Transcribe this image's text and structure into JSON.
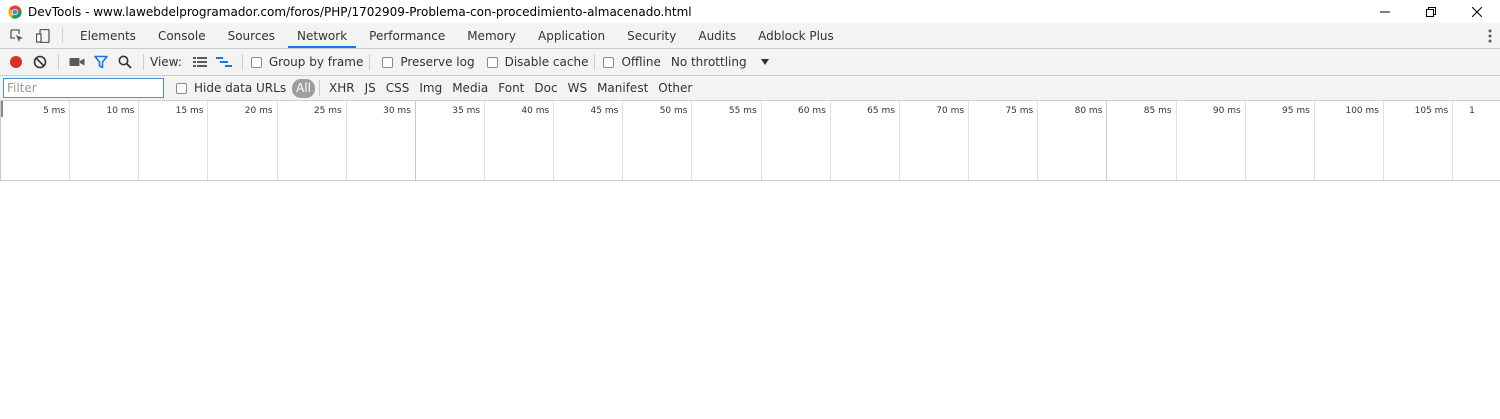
{
  "window": {
    "title": "DevTools - www.lawebdelprogramador.com/foros/PHP/1702909-Problema-con-procedimiento-almacenado.html",
    "app_icon": "chrome-icon",
    "controls": [
      "minimize-icon",
      "maximize-icon",
      "close-icon"
    ]
  },
  "tabs": [
    {
      "label": "Elements",
      "active": false
    },
    {
      "label": "Console",
      "active": false
    },
    {
      "label": "Sources",
      "active": false
    },
    {
      "label": "Network",
      "active": true
    },
    {
      "label": "Performance",
      "active": false
    },
    {
      "label": "Memory",
      "active": false
    },
    {
      "label": "Application",
      "active": false
    },
    {
      "label": "Security",
      "active": false
    },
    {
      "label": "Audits",
      "active": false
    },
    {
      "label": "Adblock Plus",
      "active": false
    }
  ],
  "toolbar": {
    "view_label": "View:",
    "group_by_frame": "Group by frame",
    "preserve_log": "Preserve log",
    "disable_cache": "Disable cache",
    "offline": "Offline",
    "throttling": "No throttling"
  },
  "filterbar": {
    "placeholder": "Filter",
    "hide_data_urls": "Hide data URLs",
    "types": [
      "All",
      "XHR",
      "JS",
      "CSS",
      "Img",
      "Media",
      "Font",
      "Doc",
      "WS",
      "Manifest",
      "Other"
    ],
    "active_type": "All"
  },
  "timeline": {
    "ticks": [
      "5 ms",
      "10 ms",
      "15 ms",
      "20 ms",
      "25 ms",
      "30 ms",
      "35 ms",
      "40 ms",
      "45 ms",
      "50 ms",
      "55 ms",
      "60 ms",
      "65 ms",
      "70 ms",
      "75 ms",
      "80 ms",
      "85 ms",
      "90 ms",
      "95 ms",
      "100 ms",
      "105 ms",
      "1"
    ]
  },
  "colors": {
    "record": "#d93025",
    "accent": "#1a73e8",
    "active_tab_underline": "#1a73e8"
  }
}
